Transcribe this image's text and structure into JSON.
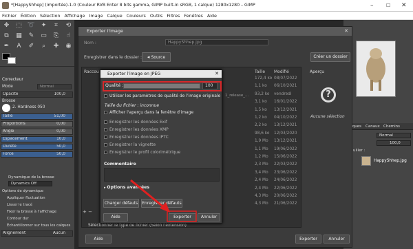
{
  "window": {
    "title": "*[HappyShhep] (importée)-1.0 (Couleur RVB Enter 8 bits gamma, GIMP built-in sRGB, 1 calque) 1280x1280 – GIMP"
  },
  "menu": [
    "Fichier",
    "Édition",
    "Sélection",
    "Affichage",
    "Image",
    "Calque",
    "Couleurs",
    "Outils",
    "Filtres",
    "Fenêtres",
    "Aide"
  ],
  "left_panel": {
    "mode_label": "Mode",
    "mode_value": "Normal",
    "opacity_label": "Opacité",
    "opacity_value": "100,0",
    "brush_label": "Brosse",
    "brush_value": "2. Hardness 050",
    "size_label": "Taille",
    "size_value": "51,00",
    "ratio_label": "Proportions",
    "ratio_value": "0,00",
    "angle_label": "Angle",
    "angle_value": "0,00",
    "spacing_label": "Espacement",
    "spacing_value": "10,0",
    "hardness_label": "Dureté",
    "hardness_value": "50,0",
    "force_label": "Force",
    "force_value": "50,0",
    "dynamics_label": "Dynamique de la brosse",
    "dynamics_value": "Dynamics Off",
    "opt1": "Options de dynamique",
    "opt2": "Appliquer fluctuation",
    "opt3": "Lisser le tracé",
    "opt4": "Fixer la brosse à l'affichage",
    "opt5": "Contour dur",
    "opt6": "Échantillonner sur tous les calques",
    "align_label": "Alignement",
    "align_value": "Aucun",
    "corrector": "Correcteur"
  },
  "export_dialog": {
    "title": "Exporter l'image",
    "name_label": "Nom :",
    "name_value": "HappyShhep.jpg",
    "folder_label": "Enregistrer dans le dossier :",
    "folder_value": "Source",
    "create_folder": "Créer un dossier",
    "col_places": "Raccou",
    "col_size": "Taille",
    "col_modified": "Modifié",
    "preview": "Aperçu",
    "no_selection": "Aucune sélection",
    "file_type": "Sélectionner le type de fichier (Selon l'extension)",
    "help": "Aide",
    "export": "Exporter",
    "cancel": "Annuler",
    "sizes": [
      "172,4 ko",
      "1,1 ko",
      "93,2 ko",
      "3,1 ko",
      "1,5 ko",
      "1,2 ko",
      "2,2 ko",
      "98,6 ko",
      "1,9 Mo",
      "1,1 Mo",
      "1,2 Mo",
      "2,3 Mo",
      "3,4 Mo",
      "2,4 Mo",
      "2,4 Mo",
      "4,3 Mo",
      "4,3 Mo"
    ],
    "dates": [
      "08/07/2022",
      "06/10/2021",
      "vendredi",
      "16/01/2022",
      "13/12/2021",
      "04/10/2022",
      "13/12/2021",
      "12/03/2020",
      "13/12/2021",
      "19/06/2022",
      "15/06/2022",
      "22/03/2022",
      "23/06/2022",
      "24/06/2022",
      "22/06/2022",
      "20/06/2022",
      "21/06/2022"
    ],
    "file_fragment": "1_release_..."
  },
  "jpeg_dialog": {
    "title": "Exporter l'image en JPEG",
    "quality_label": "Qualité :",
    "quality_value": "100",
    "quality_fraction": 1.0,
    "use_original": "Utiliser les paramètres de qualité de l'image originale",
    "file_size": "Taille du fichier : inconnue",
    "show_preview": "Afficher l'aperçu dans la fenêtre d'image",
    "exif": "Enregistrer les données Exif",
    "xmp": "Enregistrer les données XMP",
    "iptc": "Enregistrer les données IPTC",
    "thumb": "Enregistrer la vignette",
    "profile": "Enregistrer le profil colorimétrique",
    "comment": "Commentaire",
    "advanced": "Options avancées",
    "load_defaults": "Charger défauts",
    "save_defaults": "Enregistrer défauts",
    "help": "Aide",
    "export": "Exporter",
    "cancel": "Annuler"
  },
  "right_panel": {
    "tab_layers": "Calques",
    "tab_channels": "Canaux",
    "tab_paths": "Chemins",
    "mode": "Normal",
    "opacity": "100,0",
    "lock_label": "uiller :",
    "layer_name": "HappyShhep.jpg"
  },
  "colors": {
    "highlight": "#d8282a",
    "arrow": "#e02020"
  }
}
